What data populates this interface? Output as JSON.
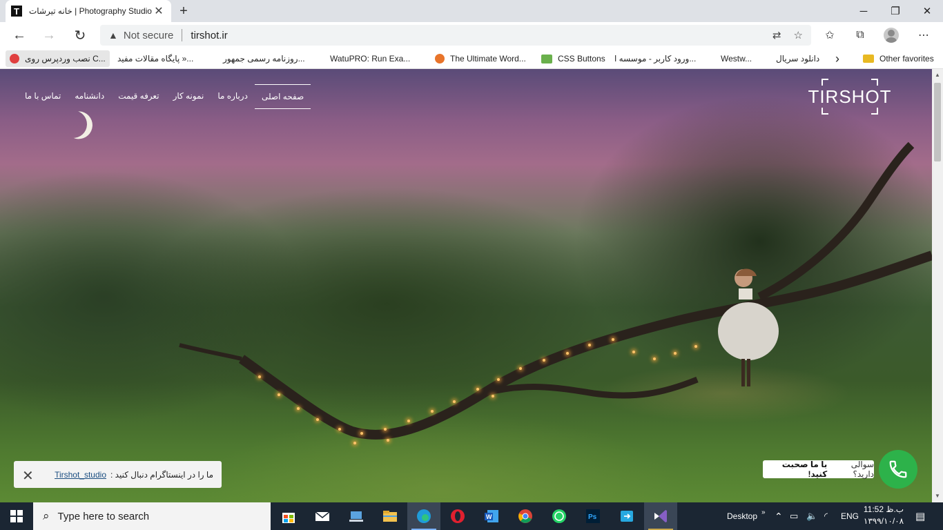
{
  "browser": {
    "tab_title": "خانه تیرشات | Photography Studio",
    "tab_favicon": "T",
    "address": {
      "security_label": "Not secure",
      "url": "tirshot.ir"
    },
    "favorites": [
      {
        "label": "نصب وردپرس روی C...",
        "icon": "wordpress-red-icon"
      },
      {
        "label": "پایگاه مقالات مفید »...",
        "icon": "page-icon"
      },
      {
        "label": "روزنامه رسمی جمهور...",
        "icon": "page-icon"
      },
      {
        "label": "WatuPRO: Run Exa...",
        "icon": "page-icon"
      },
      {
        "label": "The Ultimate Word...",
        "icon": "orange-icon"
      },
      {
        "label": "CSS Buttons",
        "icon": "green-icon"
      },
      {
        "label": "ورود کاربر - موسسه ا...",
        "icon": "page-icon"
      },
      {
        "label": "Westw...",
        "icon": "page-icon"
      },
      {
        "label": "دانلود سریال",
        "icon": "none"
      }
    ],
    "other_favorites": "Other favorites"
  },
  "site": {
    "logo": "TIRSHOT",
    "nav": [
      {
        "label": "صفحه اصلی",
        "active": true
      },
      {
        "label": "درباره ما",
        "active": false
      },
      {
        "label": "نمونه کار",
        "active": false
      },
      {
        "label": "تعرفه قیمت",
        "active": false
      },
      {
        "label": "دانشنامه",
        "active": false
      },
      {
        "label": "تماس با ما",
        "active": false
      }
    ],
    "instagram_notice": {
      "text": "ما را در اینستاگرام دنبال کنید :",
      "handle": "Tirshot_studio"
    },
    "chat": {
      "question": "سوالی دارید؟",
      "cta": "با ما صحبت کنید!"
    }
  },
  "taskbar": {
    "search_placeholder": "Type here to search",
    "apps": [
      "store-icon",
      "mail-icon",
      "laptop-icon",
      "file-explorer-icon",
      "edge-icon",
      "opera-icon",
      "word-icon",
      "chrome-icon",
      "whatsapp-icon",
      "photoshop-icon",
      "share-icon",
      "visual-studio-icon"
    ],
    "desktop_label": "Desktop",
    "language": "ENG",
    "time": "11:52 ب.ظ",
    "date": "۱۳۹۹/۱۰/۰۸"
  },
  "colors": {
    "call_button": "#2db24a",
    "taskbar": "#1b2633"
  }
}
